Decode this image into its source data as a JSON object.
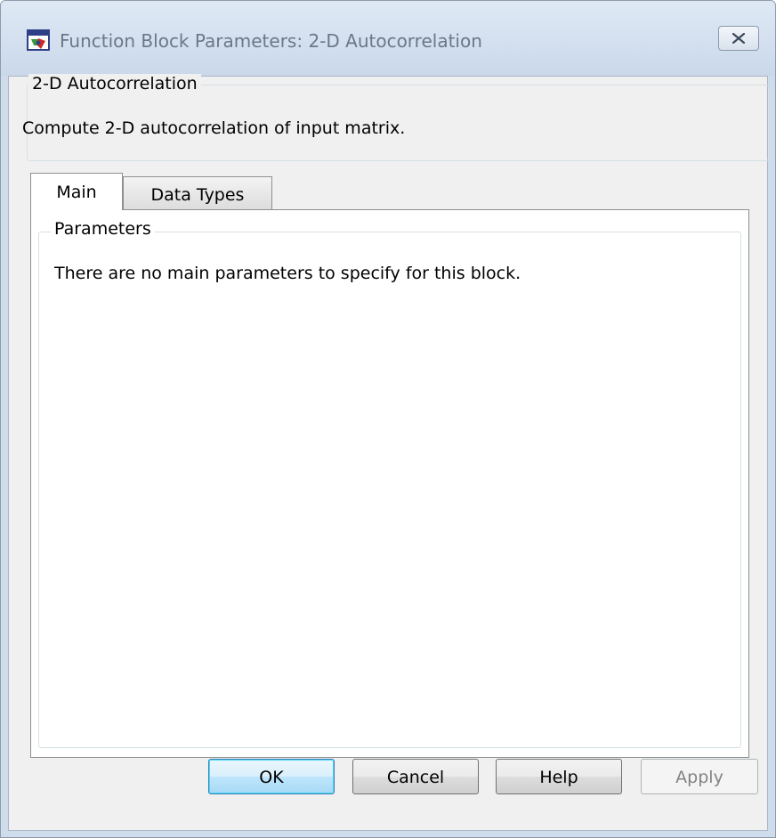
{
  "window": {
    "title": "Function Block Parameters: 2-D Autocorrelation"
  },
  "description": {
    "group_title": "2-D Autocorrelation",
    "text": "Compute 2-D autocorrelation of input matrix."
  },
  "tabs": [
    {
      "label": "Main",
      "active": true
    },
    {
      "label": "Data Types",
      "active": false
    }
  ],
  "parameters": {
    "group_title": "Parameters",
    "message": "There are no main parameters to specify for this block."
  },
  "buttons": {
    "ok": "OK",
    "cancel": "Cancel",
    "help": "Help",
    "apply": "Apply"
  },
  "colors": {
    "title_bar": "#cad8ea",
    "default_button": "#bee6fd"
  },
  "icons": {
    "app": "simulink-block-icon",
    "close": "close-x-icon"
  }
}
